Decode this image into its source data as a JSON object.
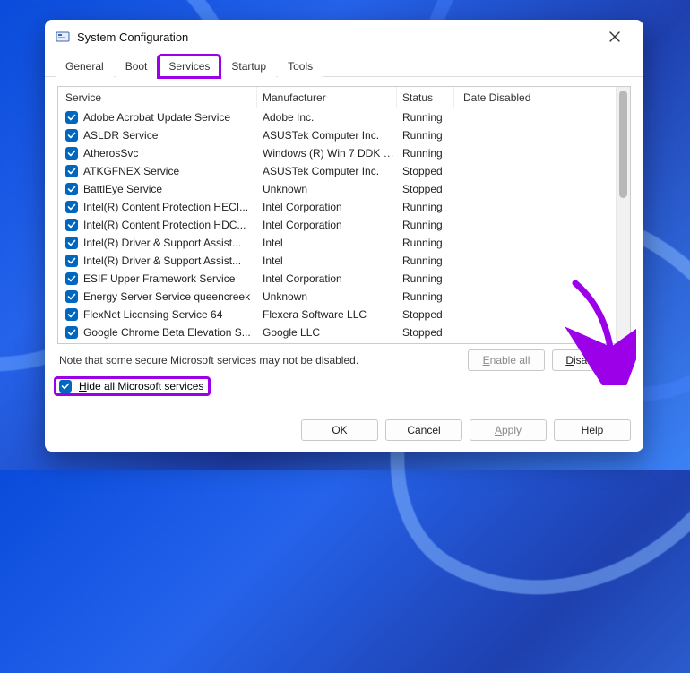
{
  "window": {
    "title": "System Configuration"
  },
  "tabs": [
    "General",
    "Boot",
    "Services",
    "Startup",
    "Tools"
  ],
  "active_tab_index": 2,
  "columns": {
    "service": "Service",
    "manufacturer": "Manufacturer",
    "status": "Status",
    "date_disabled": "Date Disabled"
  },
  "services": [
    {
      "checked": true,
      "name": "Adobe Acrobat Update Service",
      "mfr": "Adobe Inc.",
      "status": "Running"
    },
    {
      "checked": true,
      "name": "ASLDR Service",
      "mfr": "ASUSTek Computer Inc.",
      "status": "Running"
    },
    {
      "checked": true,
      "name": "AtherosSvc",
      "mfr": "Windows (R) Win 7 DDK p...",
      "status": "Running"
    },
    {
      "checked": true,
      "name": "ATKGFNEX Service",
      "mfr": "ASUSTek Computer Inc.",
      "status": "Stopped"
    },
    {
      "checked": true,
      "name": "BattlEye Service",
      "mfr": "Unknown",
      "status": "Stopped"
    },
    {
      "checked": true,
      "name": "Intel(R) Content Protection HECI...",
      "mfr": "Intel Corporation",
      "status": "Running"
    },
    {
      "checked": true,
      "name": "Intel(R) Content Protection HDC...",
      "mfr": "Intel Corporation",
      "status": "Running"
    },
    {
      "checked": true,
      "name": "Intel(R) Driver & Support Assist...",
      "mfr": "Intel",
      "status": "Running"
    },
    {
      "checked": true,
      "name": "Intel(R) Driver & Support Assist...",
      "mfr": "Intel",
      "status": "Running"
    },
    {
      "checked": true,
      "name": "ESIF Upper Framework Service",
      "mfr": "Intel Corporation",
      "status": "Running"
    },
    {
      "checked": true,
      "name": "Energy Server Service queencreek",
      "mfr": "Unknown",
      "status": "Running"
    },
    {
      "checked": true,
      "name": "FlexNet Licensing Service 64",
      "mfr": "Flexera Software LLC",
      "status": "Stopped"
    },
    {
      "checked": true,
      "name": "Google Chrome Beta Elevation S...",
      "mfr": "Google LLC",
      "status": "Stopped"
    }
  ],
  "note": "Note that some secure Microsoft services may not be disabled.",
  "hide_ms": {
    "checked": true,
    "label_pre": "H",
    "label_mid": "ide all Microsoft services"
  },
  "buttons": {
    "enable_all_pre": "E",
    "enable_all_mid": "nable all",
    "disable_all_pre": "D",
    "disable_all_mid": "isable all",
    "ok": "OK",
    "cancel": "Cancel",
    "apply_pre": "A",
    "apply_mid": "pply",
    "help": "Help"
  }
}
